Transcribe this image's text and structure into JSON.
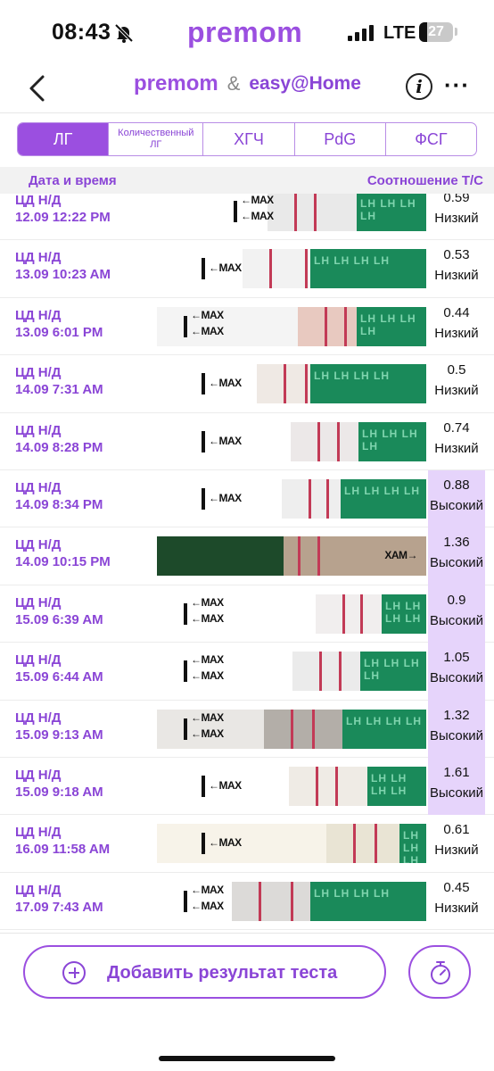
{
  "status_bar": {
    "time": "08:43",
    "network": "LTE",
    "battery": "27"
  },
  "header": {
    "brand": "premom",
    "partner_brand": "easy@Home",
    "separator": "&"
  },
  "tabs": [
    {
      "label": "ЛГ",
      "active": true
    },
    {
      "label": "Количественный ЛГ",
      "active": false
    },
    {
      "label": "ХГЧ",
      "active": false
    },
    {
      "label": "PdG",
      "active": false
    },
    {
      "label": "ФСГ",
      "active": false
    }
  ],
  "columns": {
    "datetime": "Дата и время",
    "ratio": "Соотношение Т/С"
  },
  "tests": [
    {
      "cd": "ЦД Н/Д",
      "datetime": "12.09 12:22 PM",
      "ratio": "0.59",
      "level": "Низкий",
      "high": false
    },
    {
      "cd": "ЦД Н/Д",
      "datetime": "13.09 10:23 AM",
      "ratio": "0.53",
      "level": "Низкий",
      "high": false
    },
    {
      "cd": "ЦД Н/Д",
      "datetime": "13.09 6:01 PM",
      "ratio": "0.44",
      "level": "Низкий",
      "high": false
    },
    {
      "cd": "ЦД Н/Д",
      "datetime": "14.09 7:31 AM",
      "ratio": "0.5",
      "level": "Низкий",
      "high": false
    },
    {
      "cd": "ЦД Н/Д",
      "datetime": "14.09 8:28 PM",
      "ratio": "0.74",
      "level": "Низкий",
      "high": false
    },
    {
      "cd": "ЦД Н/Д",
      "datetime": "14.09 8:34 PM",
      "ratio": "0.88",
      "level": "Высокий",
      "high": true
    },
    {
      "cd": "ЦД Н/Д",
      "datetime": "14.09 10:15 PM",
      "ratio": "1.36",
      "level": "Высокий",
      "high": true
    },
    {
      "cd": "ЦД Н/Д",
      "datetime": "15.09 6:39 AM",
      "ratio": "0.9",
      "level": "Высокий",
      "high": true
    },
    {
      "cd": "ЦД Н/Д",
      "datetime": "15.09 6:44 AM",
      "ratio": "1.05",
      "level": "Высокий",
      "high": true
    },
    {
      "cd": "ЦД Н/Д",
      "datetime": "15.09 9:13 AM",
      "ratio": "1.32",
      "level": "Высокий",
      "high": true
    },
    {
      "cd": "ЦД Н/Д",
      "datetime": "15.09 9:18 AM",
      "ratio": "1.61",
      "level": "Высокий",
      "high": true
    },
    {
      "cd": "ЦД Н/Д",
      "datetime": "16.09 11:58 AM",
      "ratio": "0.61",
      "level": "Низкий",
      "high": false
    },
    {
      "cd": "ЦД Н/Д",
      "datetime": "17.09 7:43 AM",
      "ratio": "0.45",
      "level": "Низкий",
      "high": false
    }
  ],
  "strip_text": "←MAX",
  "strip_text_mirrored": "XAM→",
  "actions": {
    "add_label": "Добавить результат теста"
  },
  "colors": {
    "accent": "#9b4fe0",
    "high_bg": "#e6d4fb",
    "strip_green": "#1a8a5a",
    "test_line": "#c23a56"
  }
}
